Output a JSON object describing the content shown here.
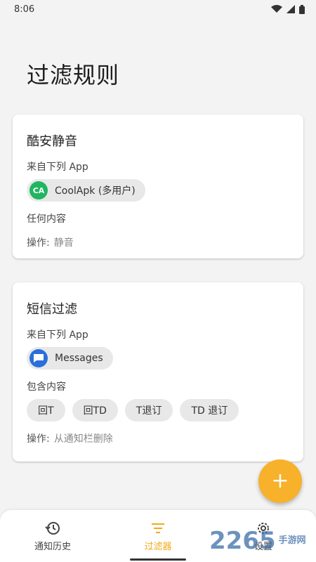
{
  "status_bar": {
    "time": "8:06"
  },
  "page": {
    "title": "过滤规则"
  },
  "cards": [
    {
      "title": "酷安静音",
      "from_label": "来自下列 App",
      "app": {
        "name": "CoolApk (多用户)",
        "icon_text": "CA"
      },
      "content_label": "任何内容",
      "action_prefix": "操作:",
      "action_value": "静音"
    },
    {
      "title": "短信过滤",
      "from_label": "来自下列 App",
      "app": {
        "name": "Messages"
      },
      "content_label": "包含内容",
      "keywords": [
        "回T",
        "回TD",
        "T退订",
        "TD 退订"
      ],
      "action_prefix": "操作:",
      "action_value": "从通知栏删除"
    }
  ],
  "fab": {
    "label": "+"
  },
  "bottom_nav": {
    "items": [
      {
        "label": "通知历史",
        "icon": "history-icon"
      },
      {
        "label": "过滤器",
        "icon": "filter-icon",
        "active": true
      },
      {
        "label": "设置",
        "icon": "gear-icon"
      }
    ]
  },
  "watermark": {
    "text": "2265",
    "subtext": "手游网"
  },
  "colors": {
    "accent": "#f7b12a",
    "active_nav": "#f2a91b",
    "coolapk": "#1fb65f",
    "messages": "#2a6fdb"
  }
}
